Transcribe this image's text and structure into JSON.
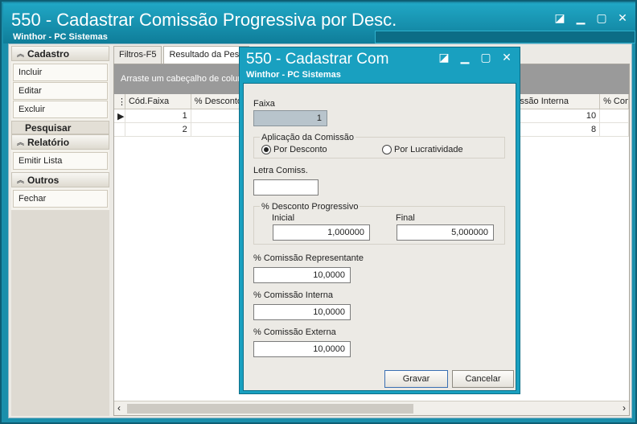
{
  "window": {
    "title": "550 - Cadastrar Comissão Progressiva por Desc.",
    "subtitle": "Winthor - PC Sistemas"
  },
  "sidebar": {
    "cadastro": {
      "header": "Cadastro",
      "items": [
        "Incluir",
        "Editar",
        "Excluir"
      ]
    },
    "pesquisar": "Pesquisar",
    "relatorio": {
      "header": "Relatório",
      "items": [
        "Emitir Lista"
      ]
    },
    "outros": {
      "header": "Outros",
      "items": [
        "Fechar"
      ]
    }
  },
  "tabs": [
    "Filtros-F5",
    "Resultado da Pesq"
  ],
  "grid": {
    "group_hint": "Arraste um cabeçalho de coluna",
    "columns": [
      "Cód.Faixa",
      "% Desconto",
      "",
      "ssão Interna",
      "% Comi"
    ],
    "rows": [
      {
        "cod": "1",
        "interna": "10"
      },
      {
        "cod": "2",
        "interna": "8"
      }
    ]
  },
  "dialog": {
    "title": "550 - Cadastrar Com",
    "subtitle": "Winthor - PC Sistemas",
    "faixa_label": "Faixa",
    "faixa_value": "1",
    "aplicacao_label": "Aplicação da Comissão",
    "radio_desconto": "Por Desconto",
    "radio_lucratividade": "Por Lucratividade",
    "letra_label": "Letra Comiss.",
    "letra_value": "",
    "desconto_group": "% Desconto Progressivo",
    "inicial_label": "Inicial",
    "inicial_value": "1,000000",
    "final_label": "Final",
    "final_value": "5,000000",
    "rep_label": "% Comissão Representante",
    "rep_value": "10,0000",
    "interna_label": "% Comissão Interna",
    "interna_value": "10,0000",
    "externa_label": "% Comissão Externa",
    "externa_value": "10,0000",
    "save_label": "Gravar",
    "cancel_label": "Cancelar"
  }
}
